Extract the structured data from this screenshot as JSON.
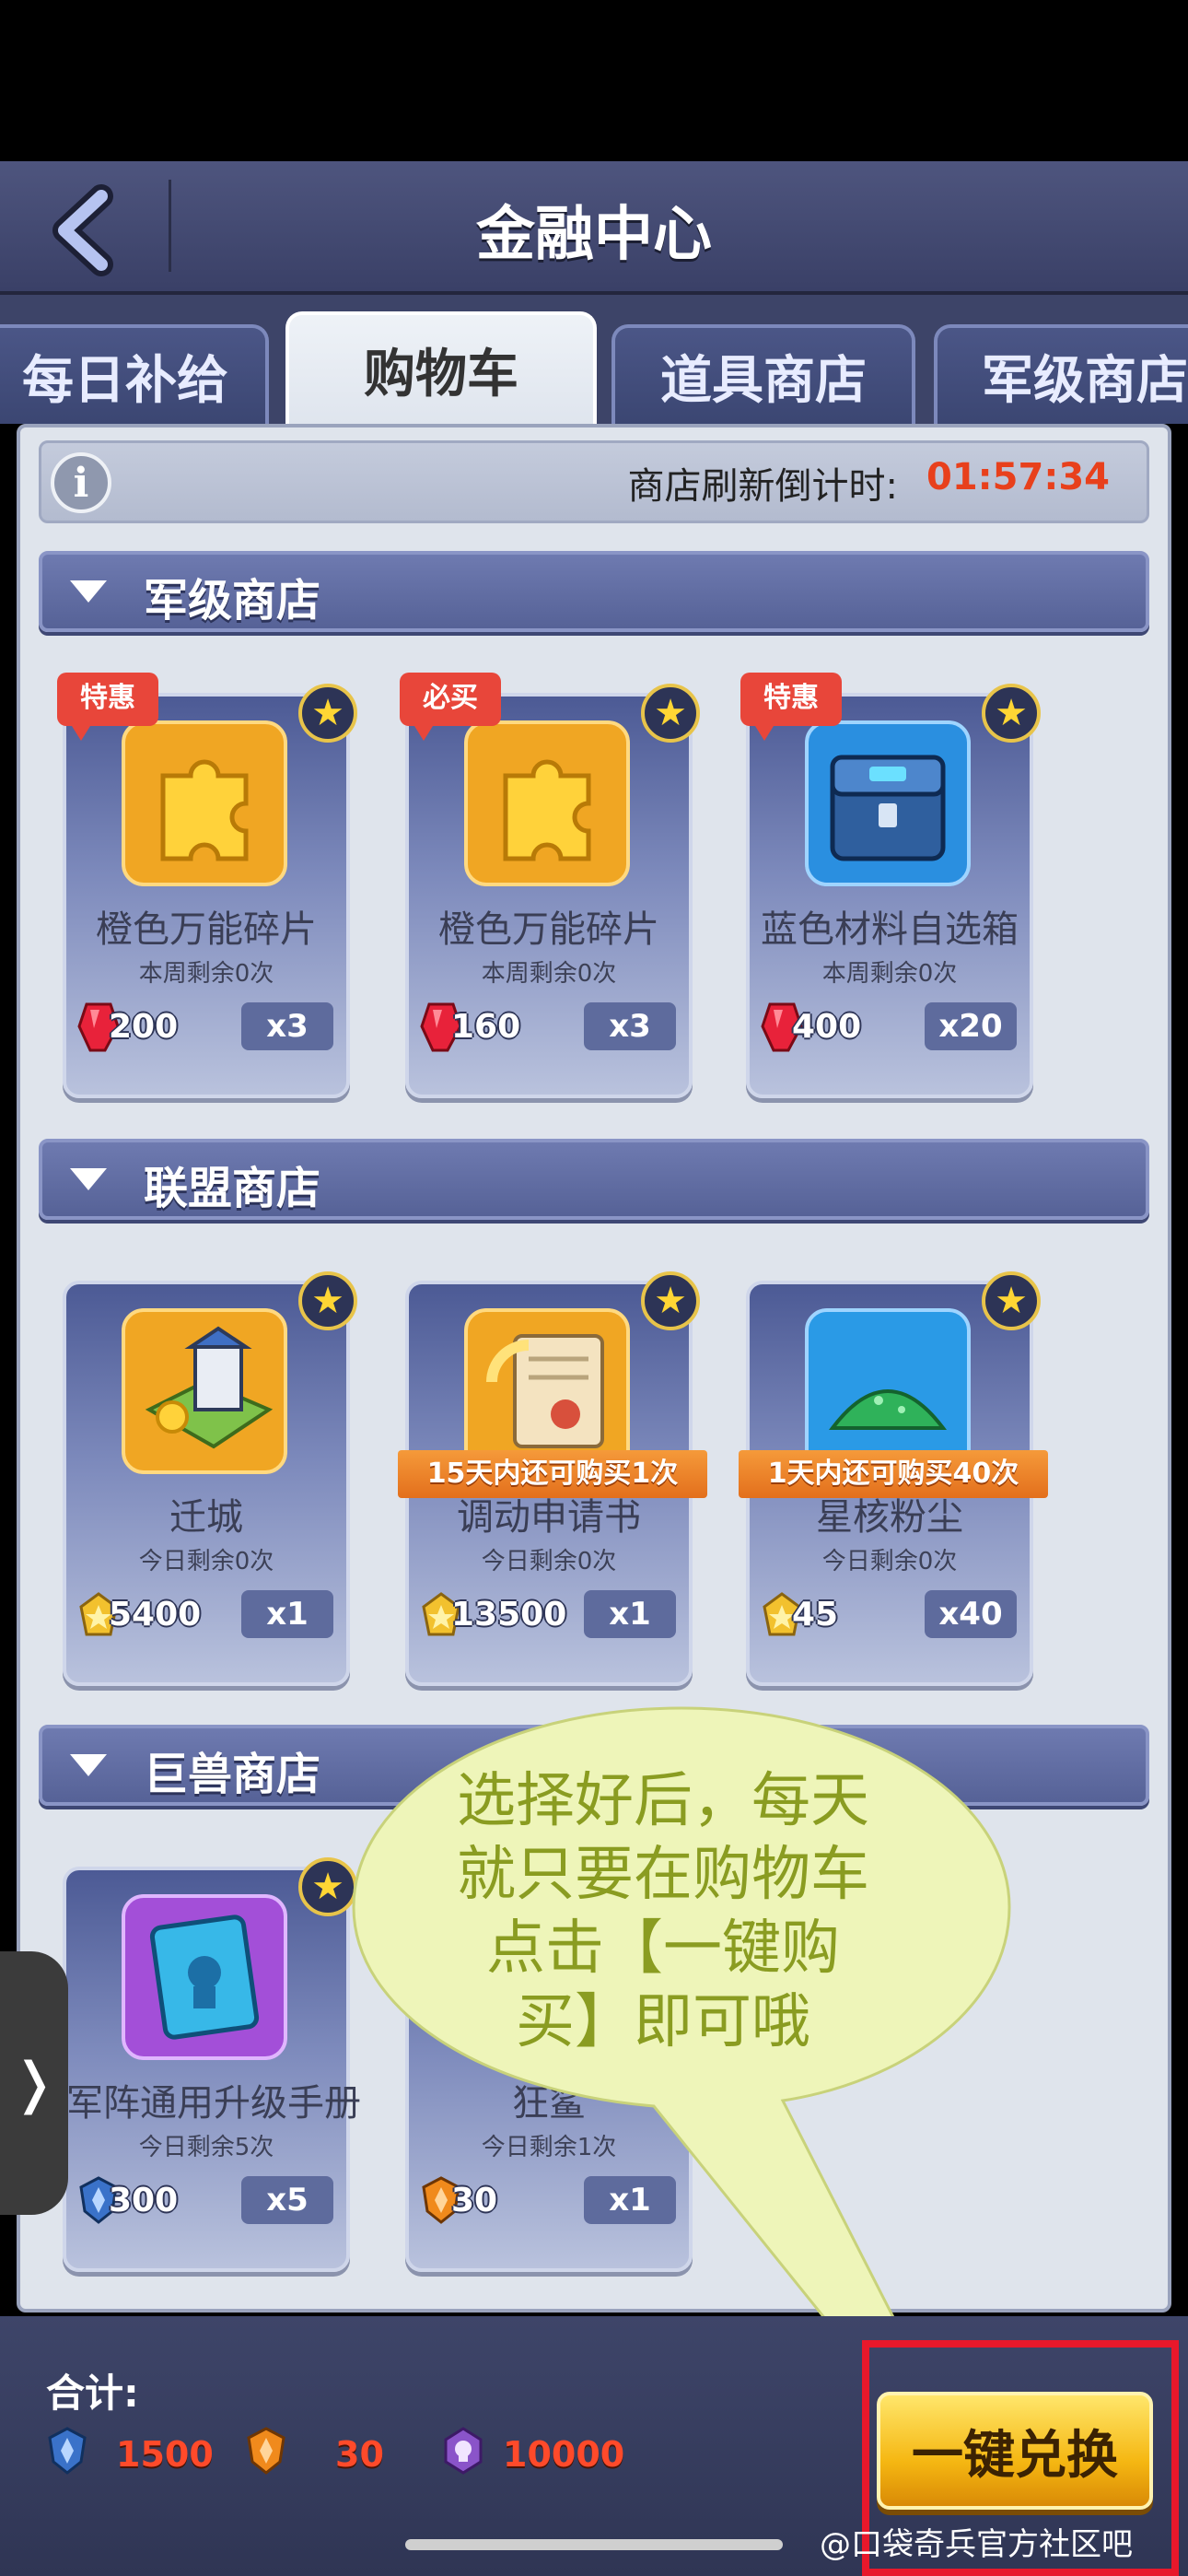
{
  "header": {
    "title": "金融中心"
  },
  "tabs": [
    {
      "label": "每日补给",
      "active": false
    },
    {
      "label": "购物车",
      "active": true
    },
    {
      "label": "道具商店",
      "active": false
    },
    {
      "label": "军级商店",
      "active": false
    }
  ],
  "info": {
    "refresh_label": "商店刷新倒计时:",
    "refresh_timer": "01:57:34"
  },
  "sections": [
    {
      "title": "军级商店",
      "items": [
        {
          "badge": "特惠",
          "name": "橙色万能碎片",
          "remain": "本周剩余0次",
          "price": "200",
          "qty": "x3",
          "currency": "ruby-icon",
          "icon": "gold-puzzle-icon"
        },
        {
          "badge": "必买",
          "name": "橙色万能碎片",
          "remain": "本周剩余0次",
          "price": "160",
          "qty": "x3",
          "currency": "ruby-icon",
          "icon": "gold-puzzle-icon"
        },
        {
          "badge": "特惠",
          "name": "蓝色材料自选箱",
          "remain": "本周剩余0次",
          "price": "400",
          "qty": "x20",
          "currency": "ruby-icon",
          "icon": "blue-chest-icon"
        }
      ]
    },
    {
      "title": "联盟商店",
      "items": [
        {
          "name": "迁城",
          "remain": "今日剩余0次",
          "price": "5400",
          "qty": "x1",
          "currency": "alliance-coin-icon",
          "icon": "relocate-city-icon"
        },
        {
          "limit": "15天内还可购买1次",
          "name": "调动申请书",
          "remain": "今日剩余0次",
          "price": "13500",
          "qty": "x1",
          "currency": "alliance-coin-icon",
          "icon": "transfer-scroll-icon"
        },
        {
          "limit": "1天内还可购买40次",
          "name": "星核粉尘",
          "remain": "今日剩余0次",
          "price": "45",
          "qty": "x40",
          "currency": "alliance-coin-icon",
          "icon": "green-dust-icon"
        }
      ]
    },
    {
      "title": "巨兽商店",
      "items": [
        {
          "name": "军阵通用升级手册",
          "remain": "今日剩余5次",
          "price": "300",
          "qty": "x5",
          "currency": "blue-shield-coin-icon",
          "icon": "purple-manual-icon"
        },
        {
          "name": "狂鲨",
          "remain": "今日剩余1次",
          "price": "30",
          "qty": "x1",
          "currency": "orange-shield-coin-icon",
          "icon": "shark-icon"
        }
      ]
    }
  ],
  "annotation": {
    "lines": [
      "选择好后，每天",
      "就只要在购物车",
      "点击【一键购",
      "买】即可哦"
    ]
  },
  "bottom": {
    "total_label": "合计:",
    "totals": [
      {
        "icon": "blue-shield-coin-icon",
        "value": "1500"
      },
      {
        "icon": "orange-shield-coin-icon",
        "value": "30"
      },
      {
        "icon": "purple-skull-coin-icon",
        "value": "10000"
      }
    ],
    "exchange_label": "一键兑换",
    "watermark": "@口袋奇兵官方社区吧"
  },
  "side_handle": "❭",
  "colors": {
    "accent_red": "#e8182b",
    "timer": "#e8401c",
    "annotation_text": "#8a9c21",
    "annotation_fill": "#eef5b9"
  }
}
